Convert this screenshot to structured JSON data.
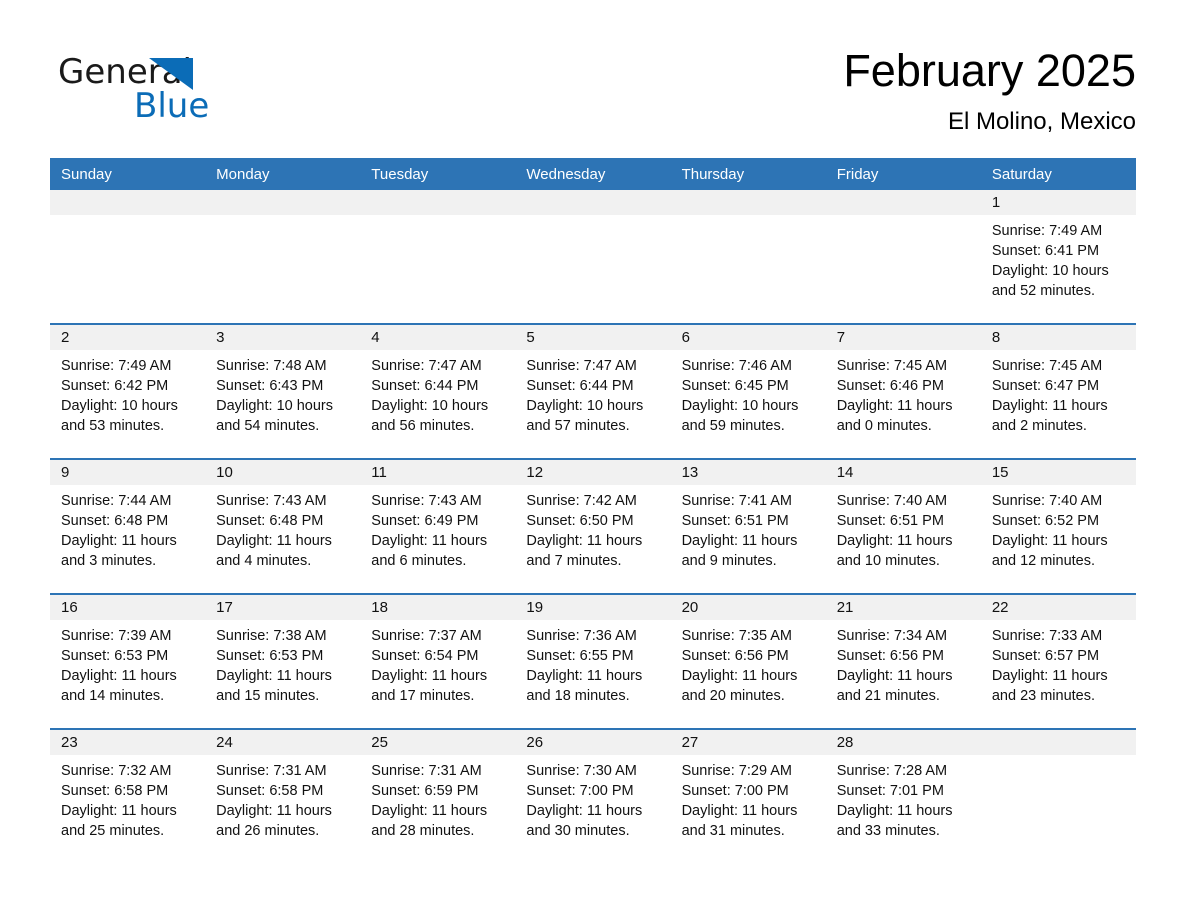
{
  "brand": {
    "name_part1": "General",
    "name_part2": "Blue",
    "accent_color": "#0b6cb7"
  },
  "header": {
    "title": "February 2025",
    "location": "El Molino, Mexico"
  },
  "theme": {
    "header_blue": "#2d74b5",
    "daynum_band": "#f1f1f1"
  },
  "weekdays": [
    "Sunday",
    "Monday",
    "Tuesday",
    "Wednesday",
    "Thursday",
    "Friday",
    "Saturday"
  ],
  "weeks": [
    [
      {
        "day": "",
        "empty": true
      },
      {
        "day": "",
        "empty": true
      },
      {
        "day": "",
        "empty": true
      },
      {
        "day": "",
        "empty": true
      },
      {
        "day": "",
        "empty": true
      },
      {
        "day": "",
        "empty": true
      },
      {
        "day": "1",
        "sunrise": "Sunrise: 7:49 AM",
        "sunset": "Sunset: 6:41 PM",
        "daylight": "Daylight: 10 hours and 52 minutes."
      }
    ],
    [
      {
        "day": "2",
        "sunrise": "Sunrise: 7:49 AM",
        "sunset": "Sunset: 6:42 PM",
        "daylight": "Daylight: 10 hours and 53 minutes."
      },
      {
        "day": "3",
        "sunrise": "Sunrise: 7:48 AM",
        "sunset": "Sunset: 6:43 PM",
        "daylight": "Daylight: 10 hours and 54 minutes."
      },
      {
        "day": "4",
        "sunrise": "Sunrise: 7:47 AM",
        "sunset": "Sunset: 6:44 PM",
        "daylight": "Daylight: 10 hours and 56 minutes."
      },
      {
        "day": "5",
        "sunrise": "Sunrise: 7:47 AM",
        "sunset": "Sunset: 6:44 PM",
        "daylight": "Daylight: 10 hours and 57 minutes."
      },
      {
        "day": "6",
        "sunrise": "Sunrise: 7:46 AM",
        "sunset": "Sunset: 6:45 PM",
        "daylight": "Daylight: 10 hours and 59 minutes."
      },
      {
        "day": "7",
        "sunrise": "Sunrise: 7:45 AM",
        "sunset": "Sunset: 6:46 PM",
        "daylight": "Daylight: 11 hours and 0 minutes."
      },
      {
        "day": "8",
        "sunrise": "Sunrise: 7:45 AM",
        "sunset": "Sunset: 6:47 PM",
        "daylight": "Daylight: 11 hours and 2 minutes."
      }
    ],
    [
      {
        "day": "9",
        "sunrise": "Sunrise: 7:44 AM",
        "sunset": "Sunset: 6:48 PM",
        "daylight": "Daylight: 11 hours and 3 minutes."
      },
      {
        "day": "10",
        "sunrise": "Sunrise: 7:43 AM",
        "sunset": "Sunset: 6:48 PM",
        "daylight": "Daylight: 11 hours and 4 minutes."
      },
      {
        "day": "11",
        "sunrise": "Sunrise: 7:43 AM",
        "sunset": "Sunset: 6:49 PM",
        "daylight": "Daylight: 11 hours and 6 minutes."
      },
      {
        "day": "12",
        "sunrise": "Sunrise: 7:42 AM",
        "sunset": "Sunset: 6:50 PM",
        "daylight": "Daylight: 11 hours and 7 minutes."
      },
      {
        "day": "13",
        "sunrise": "Sunrise: 7:41 AM",
        "sunset": "Sunset: 6:51 PM",
        "daylight": "Daylight: 11 hours and 9 minutes."
      },
      {
        "day": "14",
        "sunrise": "Sunrise: 7:40 AM",
        "sunset": "Sunset: 6:51 PM",
        "daylight": "Daylight: 11 hours and 10 minutes."
      },
      {
        "day": "15",
        "sunrise": "Sunrise: 7:40 AM",
        "sunset": "Sunset: 6:52 PM",
        "daylight": "Daylight: 11 hours and 12 minutes."
      }
    ],
    [
      {
        "day": "16",
        "sunrise": "Sunrise: 7:39 AM",
        "sunset": "Sunset: 6:53 PM",
        "daylight": "Daylight: 11 hours and 14 minutes."
      },
      {
        "day": "17",
        "sunrise": "Sunrise: 7:38 AM",
        "sunset": "Sunset: 6:53 PM",
        "daylight": "Daylight: 11 hours and 15 minutes."
      },
      {
        "day": "18",
        "sunrise": "Sunrise: 7:37 AM",
        "sunset": "Sunset: 6:54 PM",
        "daylight": "Daylight: 11 hours and 17 minutes."
      },
      {
        "day": "19",
        "sunrise": "Sunrise: 7:36 AM",
        "sunset": "Sunset: 6:55 PM",
        "daylight": "Daylight: 11 hours and 18 minutes."
      },
      {
        "day": "20",
        "sunrise": "Sunrise: 7:35 AM",
        "sunset": "Sunset: 6:56 PM",
        "daylight": "Daylight: 11 hours and 20 minutes."
      },
      {
        "day": "21",
        "sunrise": "Sunrise: 7:34 AM",
        "sunset": "Sunset: 6:56 PM",
        "daylight": "Daylight: 11 hours and 21 minutes."
      },
      {
        "day": "22",
        "sunrise": "Sunrise: 7:33 AM",
        "sunset": "Sunset: 6:57 PM",
        "daylight": "Daylight: 11 hours and 23 minutes."
      }
    ],
    [
      {
        "day": "23",
        "sunrise": "Sunrise: 7:32 AM",
        "sunset": "Sunset: 6:58 PM",
        "daylight": "Daylight: 11 hours and 25 minutes."
      },
      {
        "day": "24",
        "sunrise": "Sunrise: 7:31 AM",
        "sunset": "Sunset: 6:58 PM",
        "daylight": "Daylight: 11 hours and 26 minutes."
      },
      {
        "day": "25",
        "sunrise": "Sunrise: 7:31 AM",
        "sunset": "Sunset: 6:59 PM",
        "daylight": "Daylight: 11 hours and 28 minutes."
      },
      {
        "day": "26",
        "sunrise": "Sunrise: 7:30 AM",
        "sunset": "Sunset: 7:00 PM",
        "daylight": "Daylight: 11 hours and 30 minutes."
      },
      {
        "day": "27",
        "sunrise": "Sunrise: 7:29 AM",
        "sunset": "Sunset: 7:00 PM",
        "daylight": "Daylight: 11 hours and 31 minutes."
      },
      {
        "day": "28",
        "sunrise": "Sunrise: 7:28 AM",
        "sunset": "Sunset: 7:01 PM",
        "daylight": "Daylight: 11 hours and 33 minutes."
      },
      {
        "day": "",
        "empty": true
      }
    ]
  ]
}
